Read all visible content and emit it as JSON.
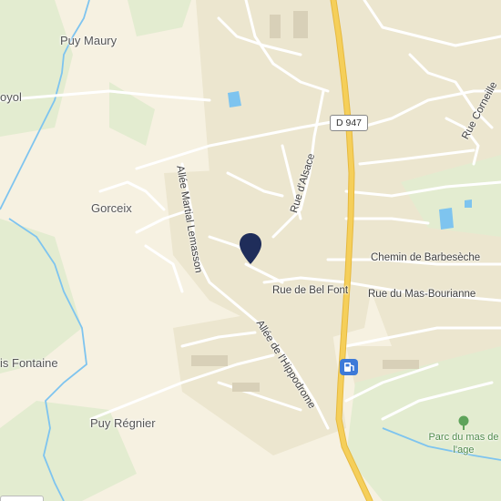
{
  "map": {
    "colors": {
      "background": "#f6f1e1",
      "residential": "#ece6cf",
      "green": "#e3ecd0",
      "water": "#7ec4ef",
      "main_road": "#f5cf5a",
      "local_road": "#ffffff",
      "pin": "#1f2d5a",
      "park_label": "#4f8a4a"
    },
    "places": {
      "puy_maury": "Puy Maury",
      "oyol": "oyol",
      "gorceix": "Gorceix",
      "is_fontaine": "is Fontaine",
      "puy_regnier": "Puy Régnier"
    },
    "road_shield": "D 947",
    "streets": {
      "rue_corneille": "Rue Corneille",
      "rue_dalsace": "Rue d'Alsace",
      "allee_martial": "Allée Martial Lemasson",
      "chemin_barbeseche": "Chemin de Barbesèche",
      "rue_bel_font": "Rue de Bel Font",
      "rue_mas_bourianne": "Rue du Mas-Bourianne",
      "allee_hippodrome": "Allée de l'Hippodrome"
    },
    "park": "Parc du mas de l'age",
    "icons": [
      "location-pin-icon",
      "fuel-station-icon",
      "park-tree-icon"
    ]
  }
}
